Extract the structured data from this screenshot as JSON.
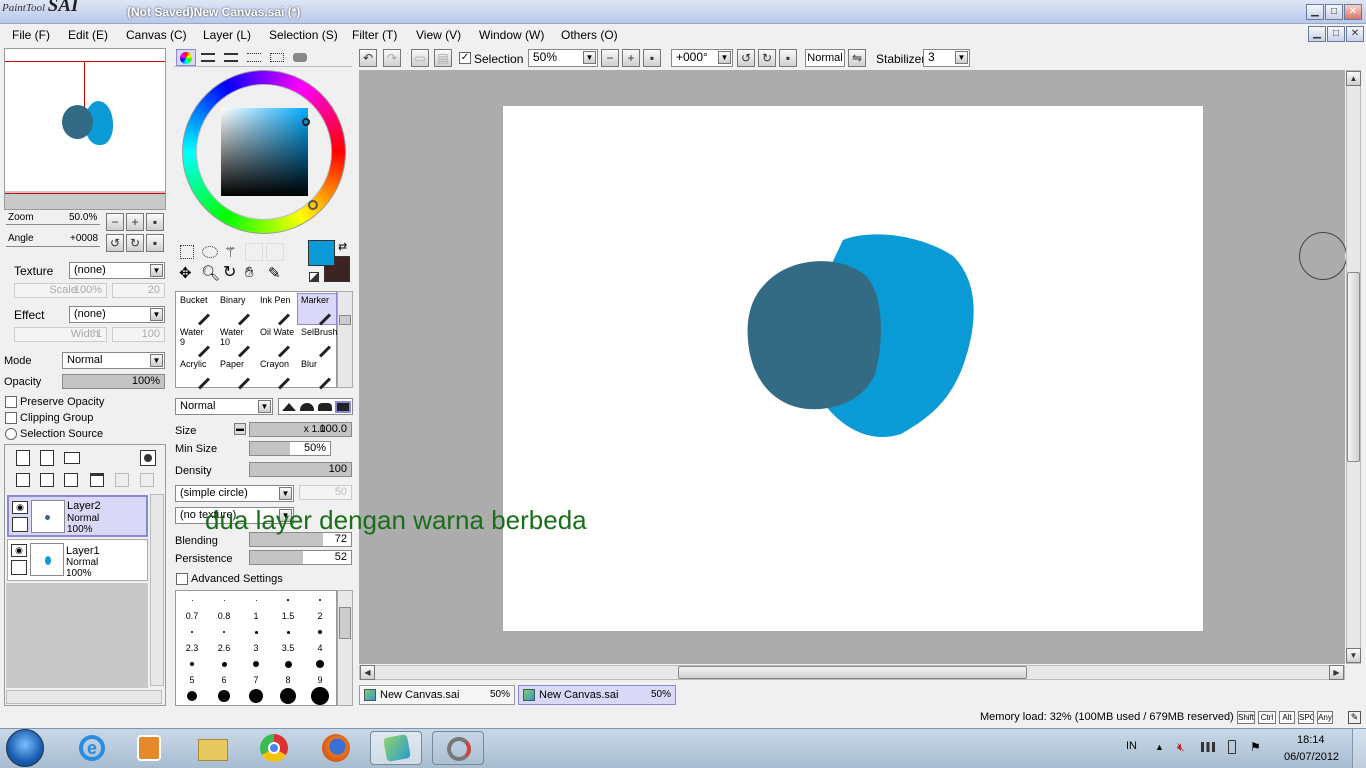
{
  "window": {
    "logo_small": "PaintTool",
    "logo_big": "SAI",
    "title": "(Not Saved)New Canvas.sai (*)"
  },
  "menu": [
    "File (F)",
    "Edit (E)",
    "Canvas (C)",
    "Layer (L)",
    "Selection (S)",
    "Filter (T)",
    "View (V)",
    "Window (W)",
    "Others (O)"
  ],
  "navigator": {
    "zoom_label": "Zoom",
    "zoom_value": "50.0%",
    "angle_label": "Angle",
    "angle_value": "+0008"
  },
  "layer_props": {
    "texture_label": "Texture",
    "texture_value": "(none)",
    "scale_label": "Scale",
    "scale_value": "100%",
    "scale_num": "20",
    "effect_label": "Effect",
    "effect_value": "(none)",
    "width_label": "Width",
    "width_value": "1",
    "width_num": "100",
    "mode_label": "Mode",
    "mode_value": "Normal",
    "opacity_label": "Opacity",
    "opacity_value": "100%",
    "preserve_opacity": "Preserve Opacity",
    "clipping_group": "Clipping Group",
    "selection_source": "Selection Source"
  },
  "layers": [
    {
      "name": "Layer2",
      "mode": "Normal",
      "opacity": "100%",
      "selected": true,
      "color": "#336b85"
    },
    {
      "name": "Layer1",
      "mode": "Normal",
      "opacity": "100%",
      "selected": false,
      "color": "#0a9ad6"
    }
  ],
  "colors": {
    "foreground": "#0a9ad6",
    "background": "#3a2320",
    "accent": "#d9d8f7",
    "shape_dark": "#336b85",
    "shape_light": "#0a9ad6",
    "overlay_text": "#1a6e1a"
  },
  "tools": [
    {
      "label": "Bucket",
      "num": ""
    },
    {
      "label": "Binary",
      "num": ""
    },
    {
      "label": "Ink Pen",
      "num": ""
    },
    {
      "label": "Marker",
      "num": ""
    },
    {
      "label": "Water",
      "num": "9"
    },
    {
      "label": "Water",
      "num": "10"
    },
    {
      "label": "Oil Wate",
      "num": ""
    },
    {
      "label": "SelBrush",
      "num": ""
    },
    {
      "label": "Acrylic",
      "num": ""
    },
    {
      "label": "Paper",
      "num": ""
    },
    {
      "label": "Crayon",
      "num": ""
    },
    {
      "label": "Blur",
      "num": ""
    }
  ],
  "brush": {
    "blend_mode": "Normal",
    "size_label": "Size",
    "size_mult": "x 1.0",
    "size_value": "100.0",
    "minsize_label": "Min Size",
    "minsize_value": "50%",
    "minsize_fill": 0.5,
    "density_label": "Density",
    "density_value": "100",
    "shape_value": "(simple circle)",
    "shape_num": "50",
    "texture_value": "(no texture)",
    "blending_label": "Blending",
    "blending_value": "72",
    "blending_fill": 0.72,
    "persistence_label": "Persistence",
    "persistence_value": "52",
    "persistence_fill": 0.52,
    "advanced": "Advanced Settings"
  },
  "brush_sizes": [
    "0.7",
    "0.8",
    "1",
    "1.5",
    "2",
    "2.3",
    "2.6",
    "3",
    "3.5",
    "4",
    "5",
    "6",
    "7",
    "8",
    "9"
  ],
  "toolbar": {
    "selection_label": "Selection",
    "zoom_value": "50%",
    "angle_value": "+000°",
    "blend_mode": "Normal",
    "stabilizer_label": "Stabilizer",
    "stabilizer_value": "3"
  },
  "overlay_caption": "dua layer dengan warna berbeda",
  "tabs": [
    {
      "name": "New Canvas.sai",
      "zoom": "50%",
      "active": false
    },
    {
      "name": "New Canvas.sai",
      "zoom": "50%",
      "active": true
    }
  ],
  "status": {
    "memory": "Memory load: 32% (100MB used / 679MB reserved)",
    "keys": [
      "Shift",
      "Ctrl",
      "Alt",
      "SPC",
      "Any"
    ]
  },
  "taskbar": {
    "lang": "IN",
    "time": "18:14",
    "date": "06/07/2012"
  }
}
